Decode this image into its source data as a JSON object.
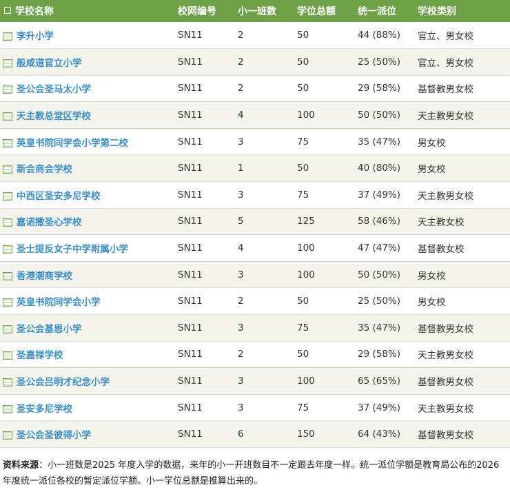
{
  "table": {
    "headers": [
      "学校名称",
      "校网编号",
      "小一班数",
      "学位总额",
      "统一派位",
      "学校类别"
    ],
    "rows": [
      {
        "name": "李升小学",
        "net": "SN11",
        "classes": "2",
        "places": "50",
        "allocation": "44 (88%)",
        "type": "官立、男女校"
      },
      {
        "name": "般咸道官立小学",
        "net": "SN11",
        "classes": "2",
        "places": "50",
        "allocation": "25 (50%)",
        "type": "官立、男女校"
      },
      {
        "name": "圣公会圣马太小学",
        "net": "SN11",
        "classes": "2",
        "places": "50",
        "allocation": "29 (58%)",
        "type": "基督教男女校"
      },
      {
        "name": "天主教总堂区学校",
        "net": "SN11",
        "classes": "4",
        "places": "100",
        "allocation": "50 (50%)",
        "type": "天主教男女校"
      },
      {
        "name": "英皇书院同学会小学第二校",
        "net": "SN11",
        "classes": "3",
        "places": "75",
        "allocation": "35 (47%)",
        "type": "男女校"
      },
      {
        "name": "新会商会学校",
        "net": "SN11",
        "classes": "1",
        "places": "50",
        "allocation": "40 (80%)",
        "type": "男女校"
      },
      {
        "name": "中西区圣安多尼学校",
        "net": "SN11",
        "classes": "3",
        "places": "75",
        "allocation": "37 (49%)",
        "type": "天主教男女校"
      },
      {
        "name": "嘉诺撒圣心学校",
        "net": "SN11",
        "classes": "5",
        "places": "125",
        "allocation": "58 (46%)",
        "type": "天主教女校"
      },
      {
        "name": "圣士提反女子中学附属小学",
        "net": "SN11",
        "classes": "4",
        "places": "100",
        "allocation": "47 (47%)",
        "type": "基督教女校"
      },
      {
        "name": "香港潮商学校",
        "net": "SN11",
        "classes": "3",
        "places": "100",
        "allocation": "50 (50%)",
        "type": "男女校"
      },
      {
        "name": "英皇书院同学会小学",
        "net": "SN11",
        "classes": "2",
        "places": "50",
        "allocation": "25 (50%)",
        "type": "男女校"
      },
      {
        "name": "圣公会基恩小学",
        "net": "SN11",
        "classes": "3",
        "places": "75",
        "allocation": "35 (47%)",
        "type": "基督教男女校"
      },
      {
        "name": "圣嘉禄学校",
        "net": "SN11",
        "classes": "2",
        "places": "50",
        "allocation": "29 (58%)",
        "type": "天主教男女校"
      },
      {
        "name": "圣公会吕明才纪念小学",
        "net": "SN11",
        "classes": "3",
        "places": "100",
        "allocation": "65 (65%)",
        "type": "基督教男女校"
      },
      {
        "name": "圣安多尼学校",
        "net": "SN11",
        "classes": "3",
        "places": "75",
        "allocation": "37 (49%)",
        "type": "天主教男女校"
      },
      {
        "name": "圣公会圣彼得小学",
        "net": "SN11",
        "classes": "6",
        "places": "150",
        "allocation": "64 (43%)",
        "type": "基督教男女校"
      }
    ]
  },
  "footnote": {
    "label": "资料来源",
    "text": "：小一班数是2025 年度入学的数据，来年的小一开班数目不一定跟去年度一样。统一派位学额是教育局公布的2026 年度统一派位各校的暂定派位学额。小一学位总额是推算出来的。"
  },
  "colors": {
    "header_bg": "#6ea148",
    "link": "#3b8fc4",
    "stripe": "#f4f4ec"
  },
  "icons": {
    "header": "checkbox-icon",
    "row": "school-list-icon"
  }
}
